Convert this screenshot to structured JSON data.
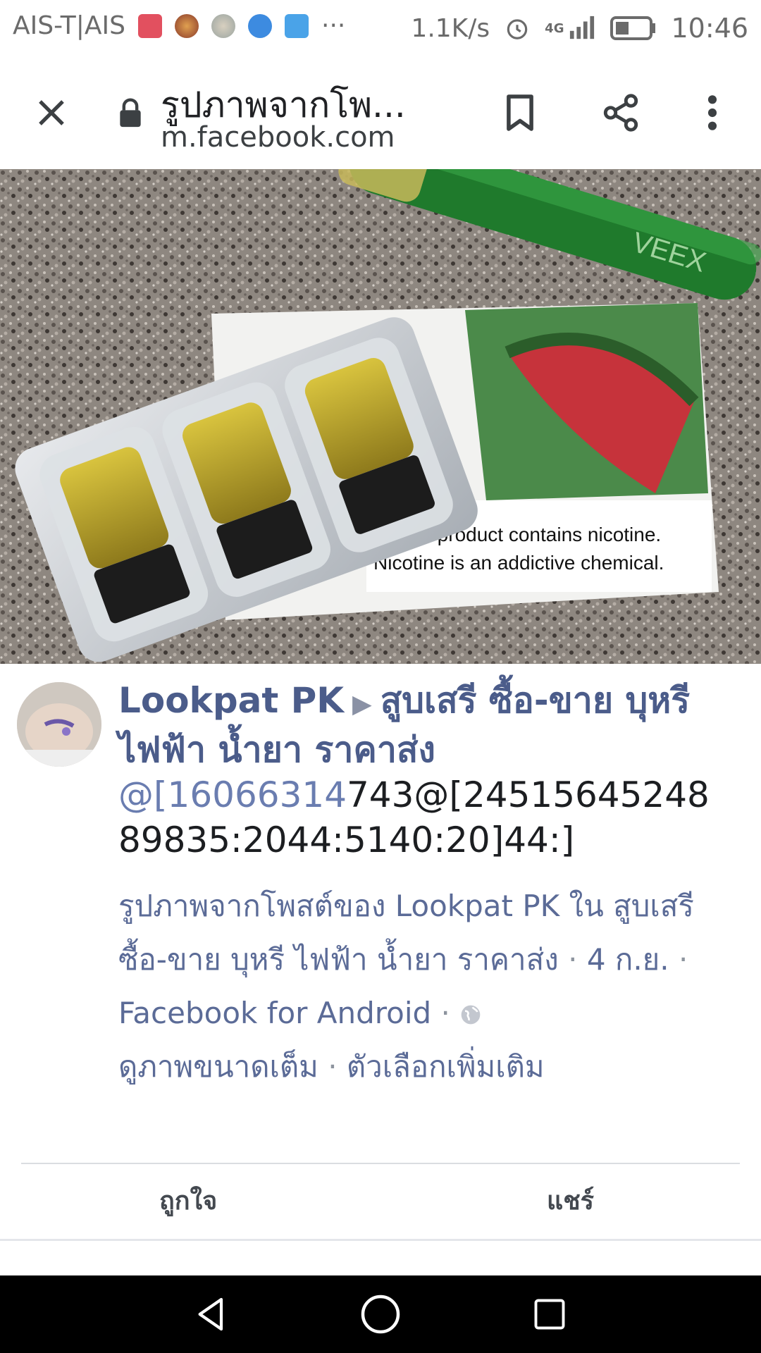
{
  "status_bar": {
    "carrier": "AIS-T|AIS",
    "overflow": "···",
    "net_speed": "1.1K/s",
    "network": "4G",
    "time": "10:46",
    "icons": [
      "sim-icon",
      "notification-avatar-icon",
      "notification-avatar-icon",
      "cloud-app-icon",
      "gallery-icon",
      "alarm-icon",
      "signal-icon",
      "battery-icon"
    ]
  },
  "toolbar": {
    "title": "รูปภาพจากโพ...",
    "url": "m.facebook.com",
    "icons": [
      "close-icon",
      "lock-icon",
      "bookmark-icon",
      "share-icon",
      "more-vert-icon"
    ]
  },
  "photo": {
    "warning_line1": "This product contains nicotine.",
    "warning_line2": "Nicotine is an addictive chemical.",
    "device_brand": "VEEX"
  },
  "post": {
    "author": "Lookpat PK",
    "group": "สูบเสรี ซื้อ-ขาย บุหรี ไฟฟ้า น้ำยา ราคาส่ง",
    "mention_part": "@[16066314",
    "text_part": "743@[24515645248 89835:2044:5140:20]44:]",
    "meta_text": "รูปภาพจากโพสต์ของ Lookpat PK ใน สูบเสรี ซื้อ-ขาย บุหรี ไฟฟ้า น้ำยา ราคาส่ง",
    "date": "4 ก.ย.",
    "source": "Facebook for Android",
    "view_full": "ดูภาพขนาดเต็ม",
    "more_options": "ตัวเลือกเพิ่มเติม",
    "separator": "·"
  },
  "actions": {
    "like": "ถูกใจ",
    "share": "แชร์"
  },
  "colors": {
    "link": "#4b5c8a",
    "meta": "#5b6b97",
    "navbar": "#000000"
  }
}
